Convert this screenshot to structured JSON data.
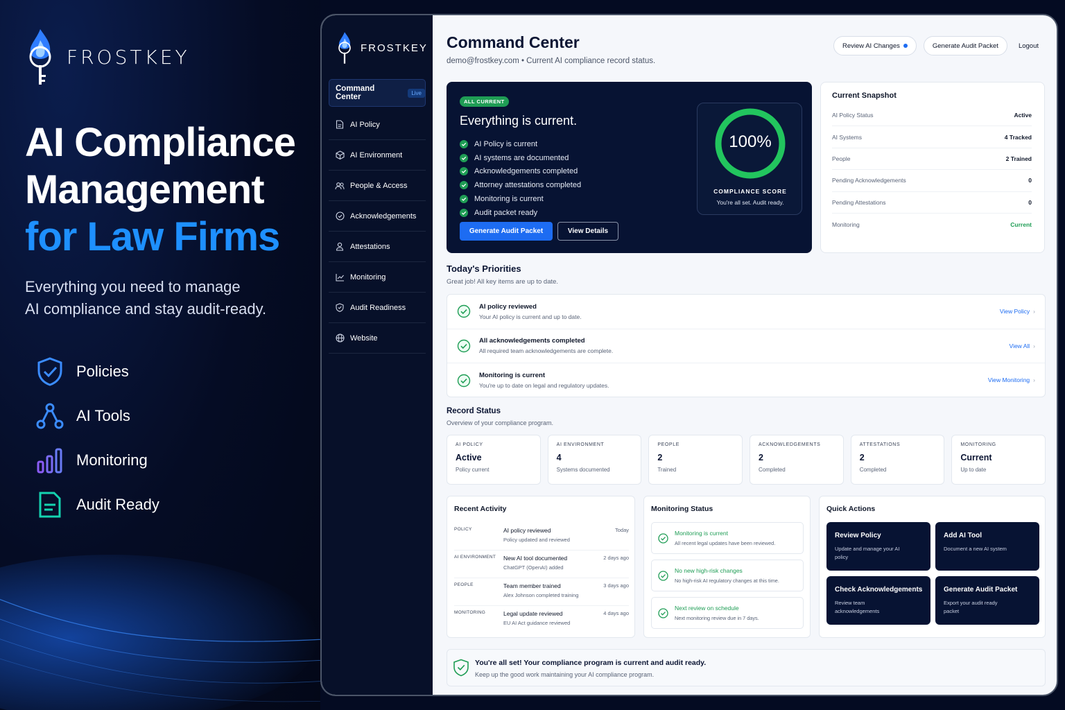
{
  "hero": {
    "brand": "FROSTKEY",
    "headline_line1": "AI Compliance",
    "headline_line2": "Management",
    "headline_line3": "for Law Firms",
    "subtext_line1": "Everything you need to manage",
    "subtext_line2": "AI compliance and stay audit-ready.",
    "features": [
      {
        "label": "Policies",
        "icon": "shield-check-icon"
      },
      {
        "label": "AI Tools",
        "icon": "nodes-icon"
      },
      {
        "label": "Monitoring",
        "icon": "bar-chart-icon"
      },
      {
        "label": "Audit Ready",
        "icon": "document-icon"
      }
    ]
  },
  "sidebar": {
    "brand": "FROSTKEY",
    "items": [
      {
        "label": "Command Center",
        "badge": "Live",
        "icon": "none"
      },
      {
        "label": "AI Policy",
        "icon": "document-icon"
      },
      {
        "label": "AI Environment",
        "icon": "cube-icon"
      },
      {
        "label": "People & Access",
        "icon": "users-icon"
      },
      {
        "label": "Acknowledgements",
        "icon": "check-circle-icon"
      },
      {
        "label": "Attestations",
        "icon": "user-icon"
      },
      {
        "label": "Monitoring",
        "icon": "line-chart-icon"
      },
      {
        "label": "Audit Readiness",
        "icon": "shield-icon"
      },
      {
        "label": "Website",
        "icon": "globe-icon"
      }
    ]
  },
  "header": {
    "title": "Command Center",
    "subtitle": "demo@frostkey.com • Current AI compliance record status.",
    "review_btn": "Review AI Changes",
    "audit_btn": "Generate Audit Packet",
    "logout": "Logout"
  },
  "status_card": {
    "badge": "ALL CURRENT",
    "heading": "Everything is current.",
    "checks": [
      "AI Policy is current",
      "AI systems are documented",
      "Acknowledgements completed",
      "Attorney attestations completed",
      "Monitoring is current",
      "Audit packet ready"
    ],
    "primary_btn": "Generate Audit Packet",
    "secondary_btn": "View Details",
    "score": "100%",
    "score_value": 1.0,
    "score_label": "COMPLIANCE SCORE",
    "score_sub": "You're all set. Audit ready."
  },
  "snapshot": {
    "title": "Current Snapshot",
    "rows": [
      {
        "k": "AI Policy Status",
        "v": "Active"
      },
      {
        "k": "AI Systems",
        "v": "4 Tracked"
      },
      {
        "k": "People",
        "v": "2 Trained"
      },
      {
        "k": "Pending Acknowledgements",
        "v": "0"
      },
      {
        "k": "Pending Attestations",
        "v": "0"
      },
      {
        "k": "Monitoring",
        "v": "Current"
      }
    ]
  },
  "priorities": {
    "title": "Today's Priorities",
    "sub": "Great job! All key items are up to date.",
    "items": [
      {
        "t": "AI policy reviewed",
        "d": "Your AI policy is current and up to date.",
        "link": "View Policy"
      },
      {
        "t": "All acknowledgements completed",
        "d": "All required team acknowledgements are complete.",
        "link": "View All"
      },
      {
        "t": "Monitoring is current",
        "d": "You're up to date on legal and regulatory updates.",
        "link": "View Monitoring"
      }
    ]
  },
  "record": {
    "title": "Record Status",
    "sub": "Overview of your compliance program.",
    "stats": [
      {
        "k": "AI POLICY",
        "v": "Active",
        "s": "Policy current"
      },
      {
        "k": "AI ENVIRONMENT",
        "v": "4",
        "s": "Systems documented"
      },
      {
        "k": "PEOPLE",
        "v": "2",
        "s": "Trained"
      },
      {
        "k": "ACKNOWLEDGEMENTS",
        "v": "2",
        "s": "Completed"
      },
      {
        "k": "ATTESTATIONS",
        "v": "2",
        "s": "Completed"
      },
      {
        "k": "MONITORING",
        "v": "Current",
        "s": "Up to date"
      }
    ]
  },
  "activity": {
    "title": "Recent Activity",
    "rows": [
      {
        "cat": "POLICY",
        "t": "AI policy reviewed",
        "d": "Policy updated and reviewed",
        "w": "Today"
      },
      {
        "cat": "AI ENVIRONMENT",
        "t": "New AI tool documented",
        "d": "ChatGPT (OpenAI) added",
        "w": "2 days ago"
      },
      {
        "cat": "PEOPLE",
        "t": "Team member trained",
        "d": "Alex Johnson completed training",
        "w": "3 days ago"
      },
      {
        "cat": "MONITORING",
        "t": "Legal update reviewed",
        "d": "EU AI Act guidance reviewed",
        "w": "4 days ago"
      }
    ]
  },
  "monitoring": {
    "title": "Monitoring Status",
    "items": [
      {
        "t": "Monitoring is current",
        "d": "All recent legal updates have been reviewed."
      },
      {
        "t": "No new high-risk changes",
        "d": "No high-risk AI regulatory changes at this time."
      },
      {
        "t": "Next review on schedule",
        "d": "Next monitoring review due in 7 days."
      }
    ]
  },
  "quick": {
    "title": "Quick Actions",
    "items": [
      {
        "t": "Review Policy",
        "d": "Update and manage your AI policy"
      },
      {
        "t": "Add AI Tool",
        "d": "Document a new AI system"
      },
      {
        "t": "Check Acknowledgements",
        "d": "Review team acknowledgements"
      },
      {
        "t": "Generate Audit Packet",
        "d": "Export your audit ready packet"
      }
    ]
  },
  "banner": {
    "t": "You're all set! Your compliance program is current and audit ready.",
    "d": "Keep up the good work maintaining your AI compliance program."
  },
  "colors": {
    "accent": "#1d6cf2",
    "success": "#1f9d55",
    "navy": "#071333",
    "hero_blue": "#1e90ff"
  }
}
